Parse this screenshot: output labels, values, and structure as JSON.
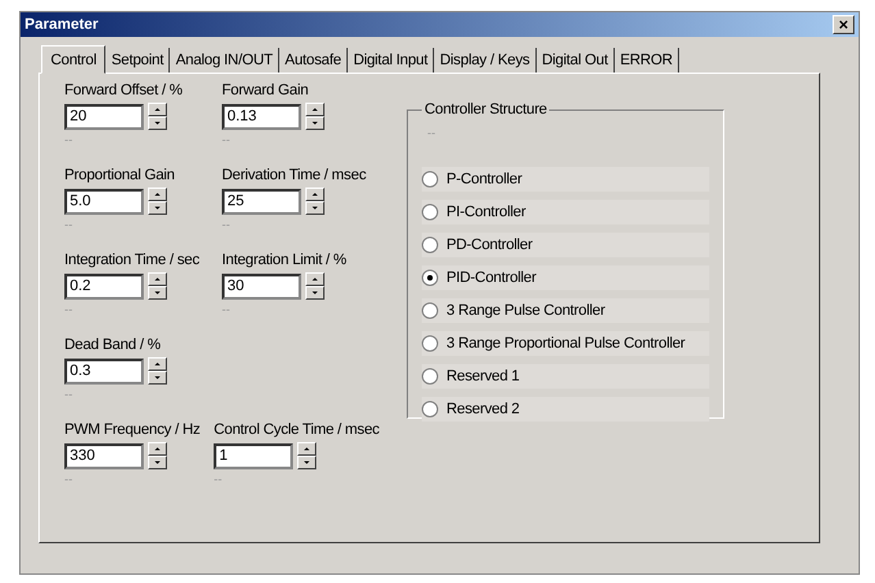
{
  "window": {
    "title": "Parameter",
    "close": "×"
  },
  "tabs": [
    {
      "label": "Control",
      "selected": true
    },
    {
      "label": "Setpoint",
      "selected": false
    },
    {
      "label": "Analog IN/OUT",
      "selected": false
    },
    {
      "label": "Autosafe",
      "selected": false
    },
    {
      "label": "Digital Input",
      "selected": false
    },
    {
      "label": "Display / Keys",
      "selected": false
    },
    {
      "label": "Digital Out",
      "selected": false
    },
    {
      "label": "ERROR",
      "selected": false
    }
  ],
  "field_rows": [
    [
      {
        "label": "Forward Offset / %",
        "value": "20",
        "note": "--"
      },
      {
        "label": "Forward Gain",
        "value": "0.13",
        "note": "--"
      }
    ],
    [
      {
        "label": "Proportional Gain",
        "value": "5.0",
        "note": "--"
      },
      {
        "label": "Derivation Time / msec",
        "value": "25",
        "note": "--"
      }
    ],
    [
      {
        "label": "Integration Time / sec",
        "value": "0.2",
        "note": "--"
      },
      {
        "label": "Integration Limit / %",
        "value": "30",
        "note": "--"
      }
    ],
    [
      {
        "label": "Dead Band / %",
        "value": "0.3",
        "note": "--"
      }
    ],
    [
      {
        "label": "PWM Frequency / Hz",
        "value": "330",
        "note": "--"
      },
      {
        "label": "Control Cycle Time / msec",
        "value": "1",
        "note": "--"
      }
    ]
  ],
  "controller_structure": {
    "title": "Controller Structure",
    "note": "--",
    "options": [
      {
        "label": "P-Controller",
        "selected": false
      },
      {
        "label": "PI-Controller",
        "selected": false
      },
      {
        "label": "PD-Controller",
        "selected": false
      },
      {
        "label": "PID-Controller",
        "selected": true
      },
      {
        "label": "3 Range Pulse Controller",
        "selected": false
      },
      {
        "label": "3 Range Proportional Pulse Controller",
        "selected": false
      },
      {
        "label": "Reserved 1",
        "selected": false
      },
      {
        "label": "Reserved 2",
        "selected": false
      }
    ]
  }
}
